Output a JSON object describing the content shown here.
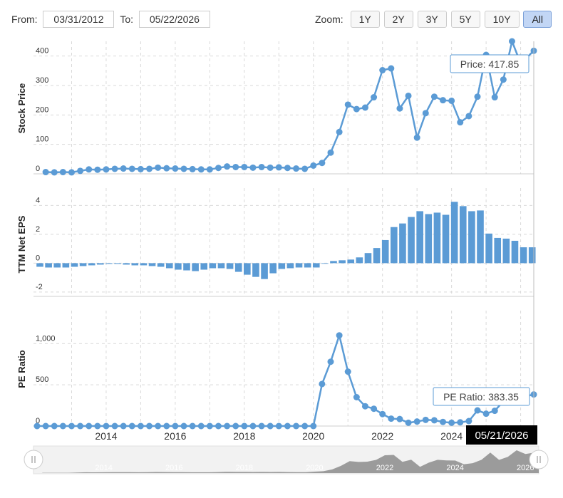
{
  "range": {
    "from_label": "From:",
    "from_value": "03/31/2012",
    "to_label": "To:",
    "to_value": "05/22/2026"
  },
  "zoom": {
    "label": "Zoom:",
    "buttons": [
      "1Y",
      "2Y",
      "3Y",
      "5Y",
      "10Y",
      "All"
    ],
    "active": "All"
  },
  "colors": {
    "series": "#5b9bd5",
    "grid": "#d9d9d9",
    "navigator_fill": "#8c8c8c",
    "tooltip_border": "#5b9bd5",
    "date_flag": "#000000"
  },
  "tooltips": {
    "price": "Price: 417.85",
    "pe": "PE Ratio: 383.35",
    "date": "05/21/2026"
  },
  "chart_data": [
    {
      "type": "line",
      "ylabel": "Stock Price",
      "ylim": [
        0,
        450
      ],
      "yticks": [
        "0",
        "100",
        "200",
        "300",
        "400"
      ],
      "x": [
        2012.25,
        2012.5,
        2012.75,
        2013.0,
        2013.25,
        2013.5,
        2013.75,
        2014.0,
        2014.25,
        2014.5,
        2014.75,
        2015.0,
        2015.25,
        2015.5,
        2015.75,
        2016.0,
        2016.25,
        2016.5,
        2016.75,
        2017.0,
        2017.25,
        2017.5,
        2017.75,
        2018.0,
        2018.25,
        2018.5,
        2018.75,
        2019.0,
        2019.25,
        2019.5,
        2019.75,
        2020.0,
        2020.25,
        2020.5,
        2020.75,
        2021.0,
        2021.25,
        2021.5,
        2021.75,
        2022.0,
        2022.25,
        2022.5,
        2022.75,
        2023.0,
        2023.25,
        2023.5,
        2023.75,
        2024.0,
        2024.25,
        2024.5,
        2024.75,
        2025.0,
        2025.25,
        2025.5,
        2025.75,
        2026.0,
        2026.38
      ],
      "values": [
        6,
        5,
        6,
        5,
        10,
        15,
        14,
        15,
        17,
        18,
        17,
        16,
        17,
        21,
        19,
        18,
        17,
        16,
        15,
        15,
        20,
        25,
        23,
        23,
        21,
        23,
        21,
        22,
        20,
        18,
        17,
        28,
        37,
        72,
        142,
        235,
        220,
        225,
        260,
        352,
        358,
        222,
        265,
        123,
        206,
        262,
        250,
        248,
        175,
        196,
        262,
        404,
        260,
        320,
        450,
        375,
        417.85
      ],
      "x_ticks": [
        "2014",
        "2016",
        "2018",
        "2020",
        "2022",
        "2024"
      ]
    },
    {
      "type": "bar",
      "ylabel": "TTM Net EPS",
      "ylim": [
        -2.3,
        5.2
      ],
      "yticks": [
        "-2",
        "0",
        "2",
        "4"
      ],
      "x": [
        2012.0,
        2012.25,
        2012.5,
        2012.75,
        2013.0,
        2013.25,
        2013.5,
        2013.75,
        2014.0,
        2014.25,
        2014.5,
        2014.75,
        2015.0,
        2015.25,
        2015.5,
        2015.75,
        2016.0,
        2016.25,
        2016.5,
        2016.75,
        2017.0,
        2017.25,
        2017.5,
        2017.75,
        2018.0,
        2018.25,
        2018.5,
        2018.75,
        2019.0,
        2019.25,
        2019.5,
        2019.75,
        2020.0,
        2020.25,
        2020.5,
        2020.75,
        2021.0,
        2021.25,
        2021.5,
        2021.75,
        2022.0,
        2022.25,
        2022.5,
        2022.75,
        2023.0,
        2023.25,
        2023.5,
        2023.75,
        2024.0,
        2024.25,
        2024.5,
        2024.75,
        2025.0,
        2025.25,
        2025.5,
        2025.75,
        2026.0,
        2026.25
      ],
      "values": [
        -0.25,
        -0.3,
        -0.3,
        -0.3,
        -0.25,
        -0.2,
        -0.15,
        -0.1,
        -0.05,
        -0.05,
        -0.1,
        -0.15,
        -0.15,
        -0.2,
        -0.25,
        -0.35,
        -0.45,
        -0.5,
        -0.55,
        -0.45,
        -0.35,
        -0.35,
        -0.4,
        -0.6,
        -0.8,
        -0.95,
        -1.1,
        -0.7,
        -0.4,
        -0.35,
        -0.3,
        -0.3,
        -0.3,
        0.0,
        0.15,
        0.2,
        0.25,
        0.4,
        0.7,
        1.05,
        1.6,
        2.5,
        2.75,
        3.2,
        3.6,
        3.4,
        3.5,
        3.35,
        4.25,
        3.95,
        3.6,
        3.65,
        2.05,
        1.75,
        1.7,
        1.55,
        1.1,
        1.1
      ]
    },
    {
      "type": "line",
      "ylabel": "PE Ratio",
      "ylim": [
        0,
        1400
      ],
      "yticks": [
        "0",
        "500",
        "1,000"
      ],
      "x": [
        2012.0,
        2012.25,
        2012.5,
        2012.75,
        2013.0,
        2013.25,
        2013.5,
        2013.75,
        2014.0,
        2014.25,
        2014.5,
        2014.75,
        2015.0,
        2015.25,
        2015.5,
        2015.75,
        2016.0,
        2016.25,
        2016.5,
        2016.75,
        2017.0,
        2017.25,
        2017.5,
        2017.75,
        2018.0,
        2018.25,
        2018.5,
        2018.75,
        2019.0,
        2019.25,
        2019.5,
        2019.75,
        2020.0,
        2020.25,
        2020.5,
        2020.75,
        2021.0,
        2021.25,
        2021.5,
        2021.75,
        2022.0,
        2022.25,
        2022.5,
        2022.75,
        2023.0,
        2023.25,
        2023.5,
        2023.75,
        2024.0,
        2024.25,
        2024.5,
        2024.75,
        2025.0,
        2025.25,
        2025.5,
        2025.75,
        2026.38
      ],
      "values": [
        0,
        0,
        0,
        0,
        0,
        0,
        0,
        0,
        0,
        0,
        0,
        0,
        0,
        0,
        0,
        0,
        0,
        0,
        0,
        0,
        0,
        0,
        0,
        0,
        0,
        0,
        0,
        0,
        0,
        0,
        0,
        0,
        0,
        510,
        780,
        1100,
        660,
        350,
        240,
        210,
        145,
        90,
        85,
        40,
        55,
        75,
        70,
        50,
        40,
        45,
        60,
        190,
        150,
        185,
        300,
        320,
        383.35
      ]
    }
  ],
  "navigator": {
    "x_ticks": [
      "2014",
      "2016",
      "2018",
      "2020",
      "2022",
      "2024",
      "2026"
    ]
  }
}
